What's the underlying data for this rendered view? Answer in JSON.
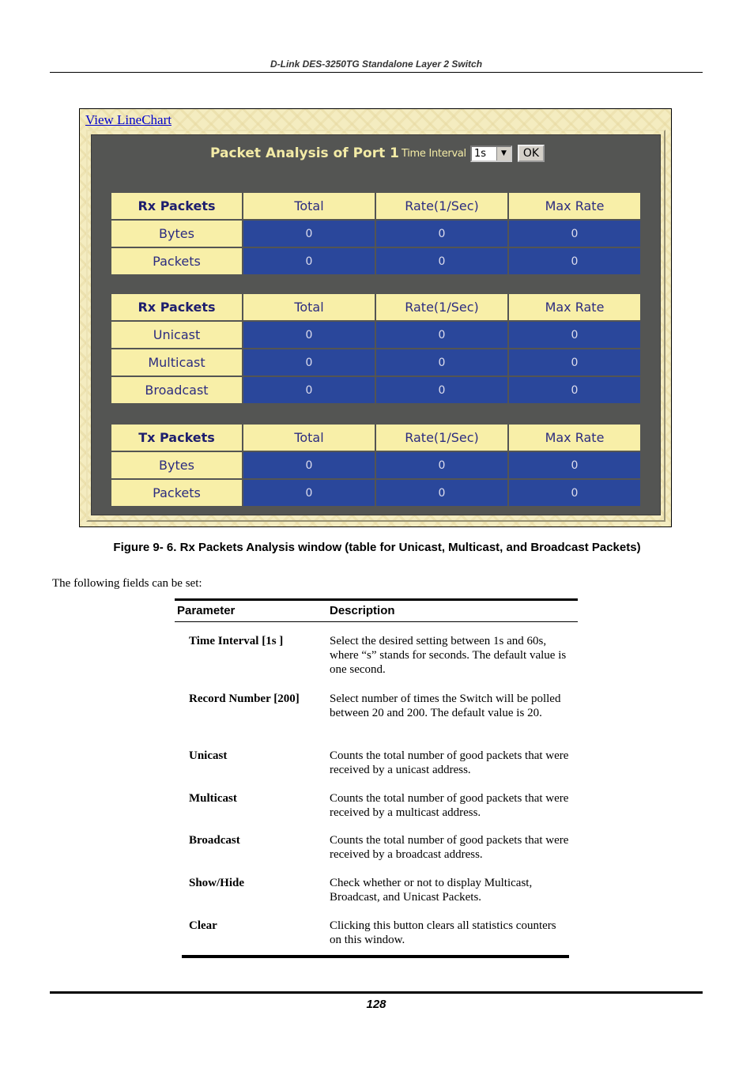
{
  "header": {
    "title": "D-Link DES-3250TG Standalone Layer 2 Switch"
  },
  "screenshot": {
    "link": "View LineChart",
    "title": "Packet Analysis of Port 1",
    "time_interval_label": "Time Interval",
    "time_interval_value": "1s",
    "ok_label": "OK",
    "tables": [
      {
        "headers": [
          "Rx Packets",
          "Total",
          "Rate(1/Sec)",
          "Max Rate"
        ],
        "rows": [
          {
            "label": "Bytes",
            "values": [
              "0",
              "0",
              "0"
            ]
          },
          {
            "label": "Packets",
            "values": [
              "0",
              "0",
              "0"
            ]
          }
        ]
      },
      {
        "headers": [
          "Rx Packets",
          "Total",
          "Rate(1/Sec)",
          "Max Rate"
        ],
        "rows": [
          {
            "label": "Unicast",
            "values": [
              "0",
              "0",
              "0"
            ]
          },
          {
            "label": "Multicast",
            "values": [
              "0",
              "0",
              "0"
            ]
          },
          {
            "label": "Broadcast",
            "values": [
              "0",
              "0",
              "0"
            ]
          }
        ]
      },
      {
        "headers": [
          "Tx Packets",
          "Total",
          "Rate(1/Sec)",
          "Max Rate"
        ],
        "rows": [
          {
            "label": "Bytes",
            "values": [
              "0",
              "0",
              "0"
            ]
          },
          {
            "label": "Packets",
            "values": [
              "0",
              "0",
              "0"
            ]
          }
        ]
      }
    ]
  },
  "caption": "Figure 9- 6.  Rx Packets Analysis window (table for Unicast, Multicast, and Broadcast Packets)",
  "intro": "The following fields can be set:",
  "param_table": {
    "headers": [
      "Parameter",
      "Description"
    ],
    "rows": [
      {
        "param": "Time Interval [1s ]",
        "desc": "Select the desired setting between 1s and 60s, where “s” stands for seconds. The default value is one second."
      },
      {
        "param": "Record Number [200]",
        "desc": "Select number of times the Switch will be polled between 20 and 200. The default value is 20."
      },
      {
        "param": "Unicast",
        "desc": "Counts the total number of good packets that were received by a unicast address."
      },
      {
        "param": "Multicast",
        "desc": "Counts the total number of good packets that were received by a multicast address."
      },
      {
        "param": "Broadcast",
        "desc": "Counts the total number of good packets that were received by a broadcast address."
      },
      {
        "param": "Show/Hide",
        "desc": "Check whether or not to display Multicast, Broadcast, and Unicast Packets."
      },
      {
        "param": "Clear",
        "desc": "Clicking this button clears all statistics counters on this window."
      }
    ]
  },
  "footer": {
    "page_number": "128"
  }
}
